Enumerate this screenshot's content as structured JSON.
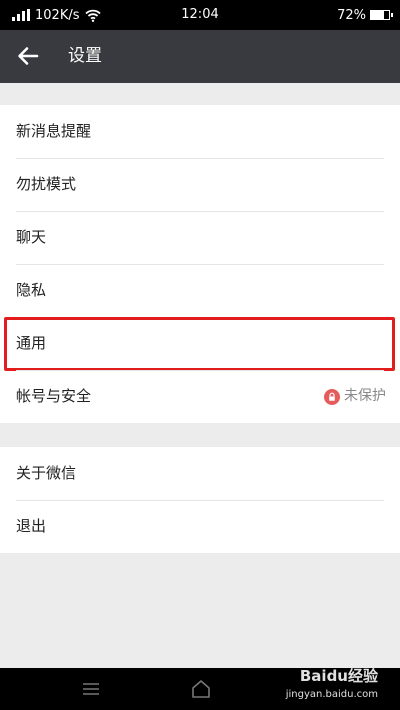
{
  "status_bar": {
    "speed": "102K/s",
    "time": "12:04",
    "battery": "72%",
    "battery_level": 0.72
  },
  "header": {
    "title": "设置",
    "back_icon": "arrow-left-icon"
  },
  "settings": {
    "group1": [
      {
        "label": "新消息提醒"
      },
      {
        "label": "勿扰模式"
      },
      {
        "label": "聊天"
      },
      {
        "label": "隐私"
      },
      {
        "label": "通用"
      },
      {
        "label": "帐号与安全",
        "status": "未保护",
        "status_icon": "lock-icon"
      }
    ],
    "group2": [
      {
        "label": "关于微信"
      },
      {
        "label": "退出"
      }
    ]
  },
  "highlight": {
    "item": "通用",
    "color": "#e11d1d"
  },
  "colors": {
    "header_bg": "#393a3f",
    "page_bg": "#ececec",
    "warning": "#e45c5c"
  },
  "watermark": {
    "brand": "Baidu经验",
    "url": "jingyan.baidu.com"
  },
  "nav_bar": {
    "icons": [
      "menu-icon",
      "home-icon"
    ]
  }
}
